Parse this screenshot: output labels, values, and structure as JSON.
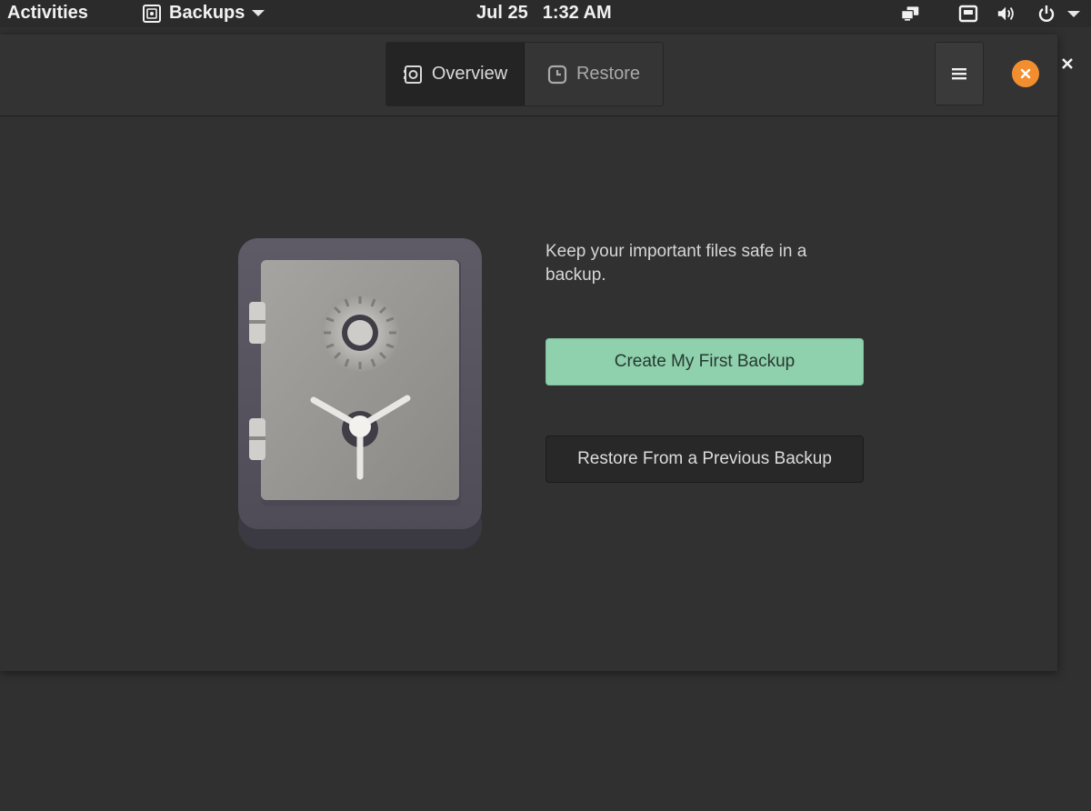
{
  "topbar": {
    "activities": "Activities",
    "app_name": "Backups",
    "date": "Jul 25",
    "time": "1:32 AM"
  },
  "icons": {
    "app": "backups-icon",
    "network": "network-icon",
    "wired": "ethernet-icon",
    "volume": "volume-icon",
    "power": "power-icon",
    "menu": "hamburger-menu-icon",
    "close": "close-icon",
    "overview_tab": "safe-icon",
    "restore_tab": "clock-icon"
  },
  "header": {
    "tabs": [
      {
        "label": "Overview",
        "active": true
      },
      {
        "label": "Restore",
        "active": false
      }
    ]
  },
  "main": {
    "tagline": "Keep your important files safe in a backup.",
    "primary_button": "Create My First Backup",
    "secondary_button": "Restore From a Previous Backup"
  },
  "colors": {
    "accent_green": "#8fd0ad",
    "close_orange": "#f38e30",
    "window_bg": "#313131"
  }
}
